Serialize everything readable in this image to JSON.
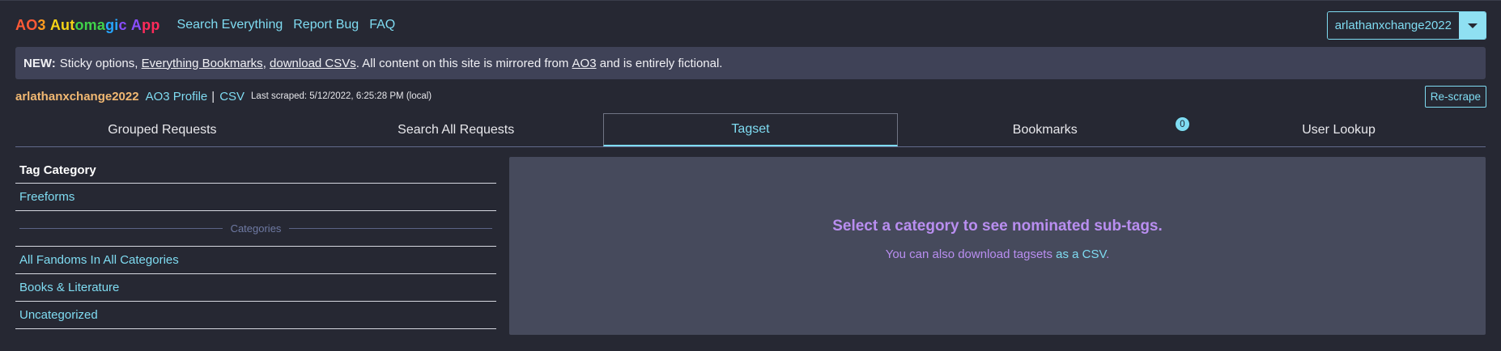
{
  "header": {
    "brand": "AO3 Automagic App",
    "nav": [
      "Search Everything",
      "Report Bug",
      "FAQ"
    ],
    "user_select": {
      "value": "arlathanxchange2022"
    }
  },
  "notice": {
    "new_label": "NEW:",
    "text_1": "Sticky options,",
    "link_bookmarks": "Everything Bookmarks",
    "text_2": ",",
    "link_csv": "download CSVs",
    "text_3": ". All content on this site is mirrored from",
    "link_ao3": "AO3",
    "text_4": "and is entirely fictional."
  },
  "user_row": {
    "username": "arlathanxchange2022",
    "profile_link": "AO3 Profile",
    "separator": "|",
    "csv_link": "CSV",
    "last_scraped": "Last scraped: 5/12/2022, 6:25:28 PM (local)",
    "rescrape_label": "Re-scrape"
  },
  "tabs": [
    {
      "label": "Grouped Requests",
      "active": false
    },
    {
      "label": "Search All Requests",
      "active": false
    },
    {
      "label": "Tagset",
      "active": true
    },
    {
      "label": "Bookmarks",
      "active": false
    },
    {
      "label": "User Lookup",
      "active": false
    }
  ],
  "bookmarks_badge": "0",
  "sidebar": {
    "header": "Tag Category",
    "top_items": [
      "Freeforms"
    ],
    "divider_label": "Categories",
    "category_items": [
      "All Fandoms In All Categories",
      "Books & Literature",
      "Uncategorized"
    ]
  },
  "panel": {
    "title": "Select a category to see nominated sub-tags.",
    "sub_prefix": "You can also download tagsets",
    "sub_link": "as a CSV",
    "sub_suffix": "."
  },
  "colors": {
    "background": "#262833",
    "accent": "#7fdcf2",
    "username": "#f1b872",
    "notice_bg": "#3f4257",
    "panel_bg": "#464a5c",
    "panel_text": "#b98ef0",
    "brand_gradient": [
      "#ff5a36",
      "#ff9a1f",
      "#f5d316",
      "#40d24a",
      "#26a6ff",
      "#8a4dff",
      "#ff2a5a"
    ]
  }
}
